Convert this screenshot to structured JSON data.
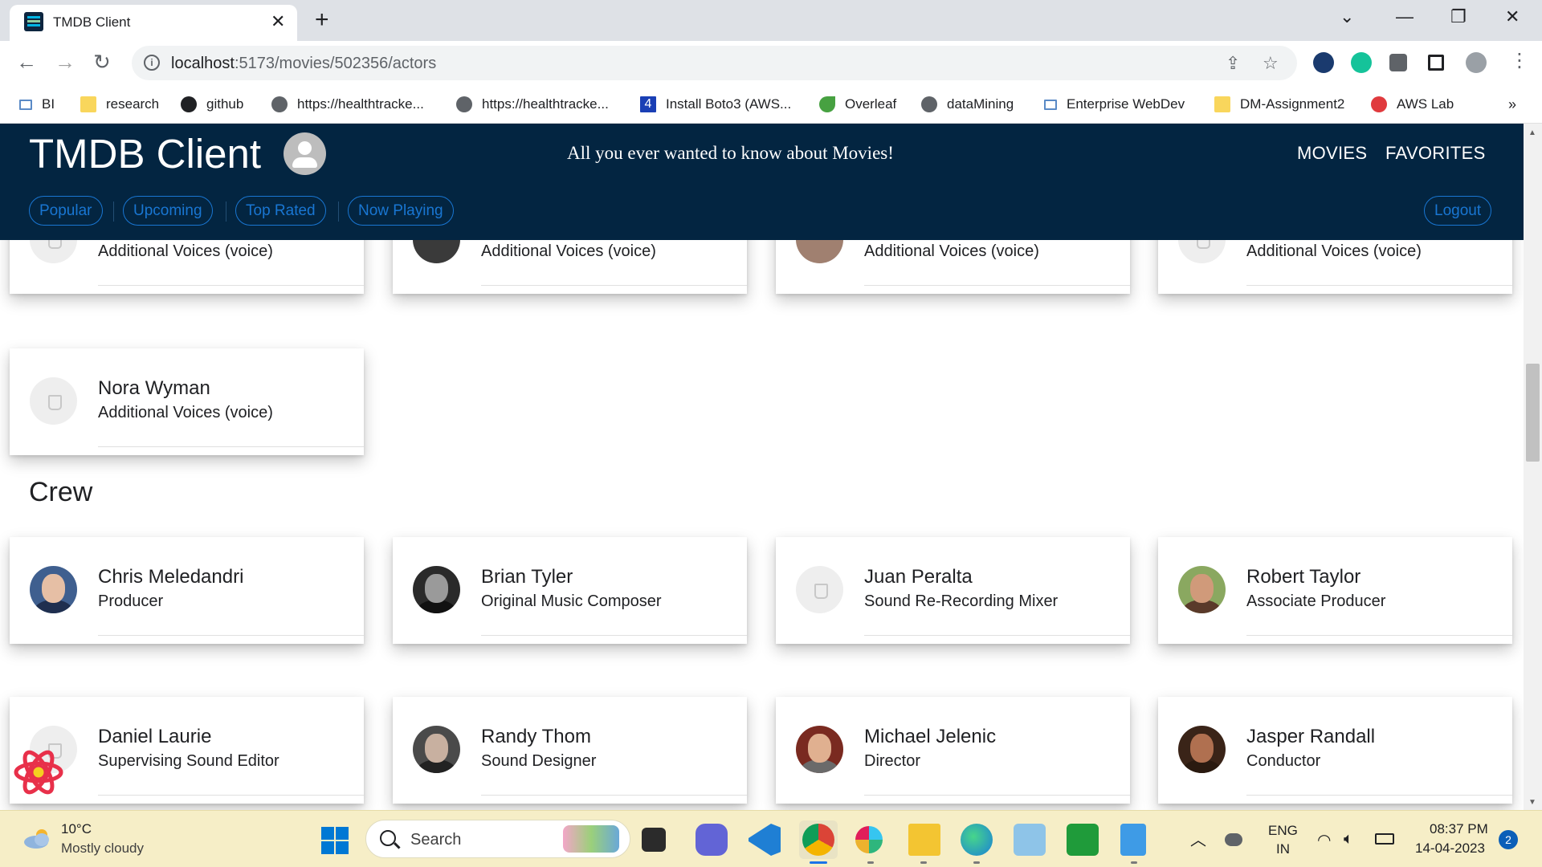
{
  "browser": {
    "tab_title": "TMDB Client",
    "url_host": "localhost",
    "url_path": ":5173/movies/502356/actors",
    "bookmarks": [
      {
        "label": "BI",
        "icon": "webpage-icon"
      },
      {
        "label": "research",
        "icon": "folder-icon"
      },
      {
        "label": "github",
        "icon": "github-icon"
      },
      {
        "label": "https://healthtracke...",
        "icon": "globe-icon"
      },
      {
        "label": "https://healthtracke...",
        "icon": "globe-icon"
      },
      {
        "label": "Install Boto3 (AWS...",
        "icon": "site-4-icon"
      },
      {
        "label": "Overleaf",
        "icon": "overleaf-icon"
      },
      {
        "label": "dataMining",
        "icon": "globe-icon"
      },
      {
        "label": "Enterprise WebDev",
        "icon": "webpage-icon"
      },
      {
        "label": "DM-Assignment2",
        "icon": "folder-icon"
      },
      {
        "label": "AWS Lab",
        "icon": "aws-icon"
      }
    ]
  },
  "app": {
    "title": "TMDB Client",
    "tagline": "All you ever wanted to know about Movies!",
    "nav": {
      "movies": "MOVIES",
      "favorites": "FAVORITES"
    },
    "categories": [
      "Popular",
      "Upcoming",
      "Top Rated",
      "Now Playing"
    ],
    "logout": "Logout"
  },
  "cast_partial": [
    {
      "role": "Additional Voices (voice)"
    },
    {
      "role": "Additional Voices (voice)"
    },
    {
      "role": "Additional Voices (voice)"
    },
    {
      "role": "Additional Voices (voice)"
    }
  ],
  "cast_last": {
    "name": "Nora Wyman",
    "role": "Additional Voices (voice)"
  },
  "crew_heading": "Crew",
  "crew": [
    {
      "name": "Chris Meledandri",
      "role": "Producer"
    },
    {
      "name": "Brian Tyler",
      "role": "Original Music Composer"
    },
    {
      "name": "Juan Peralta",
      "role": "Sound Re-Recording Mixer"
    },
    {
      "name": "Robert Taylor",
      "role": "Associate Producer"
    },
    {
      "name": "Daniel Laurie",
      "role": "Supervising Sound Editor"
    },
    {
      "name": "Randy Thom",
      "role": "Sound Designer"
    },
    {
      "name": "Michael Jelenic",
      "role": "Director"
    },
    {
      "name": "Jasper Randall",
      "role": "Conductor"
    }
  ],
  "taskbar": {
    "temperature": "10°C",
    "weather": "Mostly cloudy",
    "search_placeholder": "Search",
    "lang_1": "ENG",
    "lang_2": "IN",
    "time": "08:37 PM",
    "date": "14-04-2023",
    "notifications": "2"
  },
  "colors": {
    "header_bg": "#032541",
    "chip_blue": "#1976d2",
    "taskbar_bg": "#f6eec7"
  }
}
